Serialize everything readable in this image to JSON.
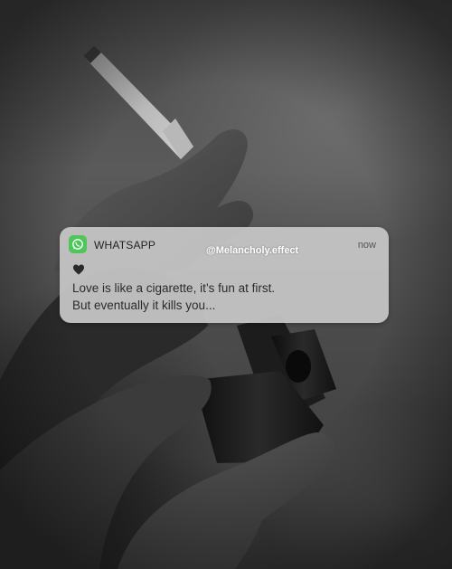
{
  "notification": {
    "app_icon": "whatsapp-icon",
    "app_name": "WHATSAPP",
    "source_handle": "@Melancholy.effect",
    "time": "now",
    "emoji_icon": "black-heart-icon",
    "message_lines": [
      "Love is like a cigarette, it’s fun at first.",
      "But eventually it kills you..."
    ]
  },
  "colors": {
    "notification_bg": "#c7c7c7",
    "whatsapp_green": "#4fc65a",
    "message_text": "#2b2b2b",
    "handle_text": "#ffffff",
    "photo_tone": "#4a4a4a"
  }
}
